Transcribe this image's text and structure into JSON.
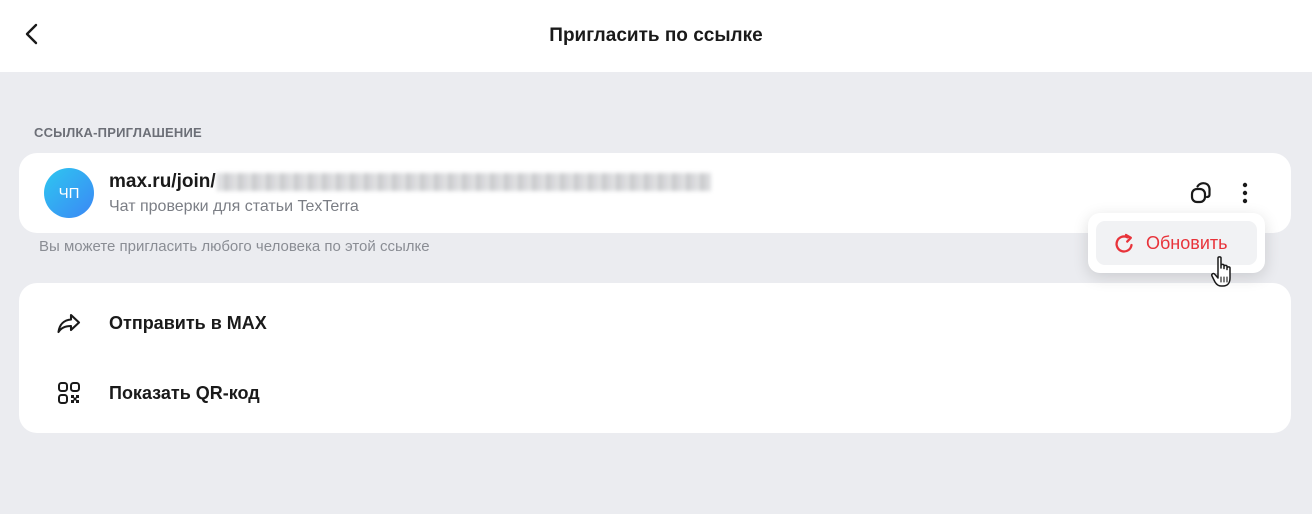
{
  "header": {
    "title": "Пригласить по ссылке"
  },
  "invite": {
    "section_label": "ССЫЛКА-ПРИГЛАШЕНИЕ",
    "avatar_initials": "ЧП",
    "link_prefix": "max.ru/join/",
    "chat_name": "Чат проверки для статьи TexTerra",
    "hint": "Вы можете пригласить любого человека по этой ссылке"
  },
  "actions": [
    {
      "label": "Отправить в MAX",
      "icon": "share-arrow-icon"
    },
    {
      "label": "Показать QR-код",
      "icon": "qr-code-icon"
    }
  ],
  "menu": {
    "refresh_label": "Обновить",
    "refresh_color": "#e8333a"
  },
  "colors": {
    "background": "#ebecf0",
    "card": "#ffffff",
    "avatar_gradient": [
      "#2ec7f0",
      "#3b87f5"
    ],
    "accent_red": "#e8333a"
  }
}
